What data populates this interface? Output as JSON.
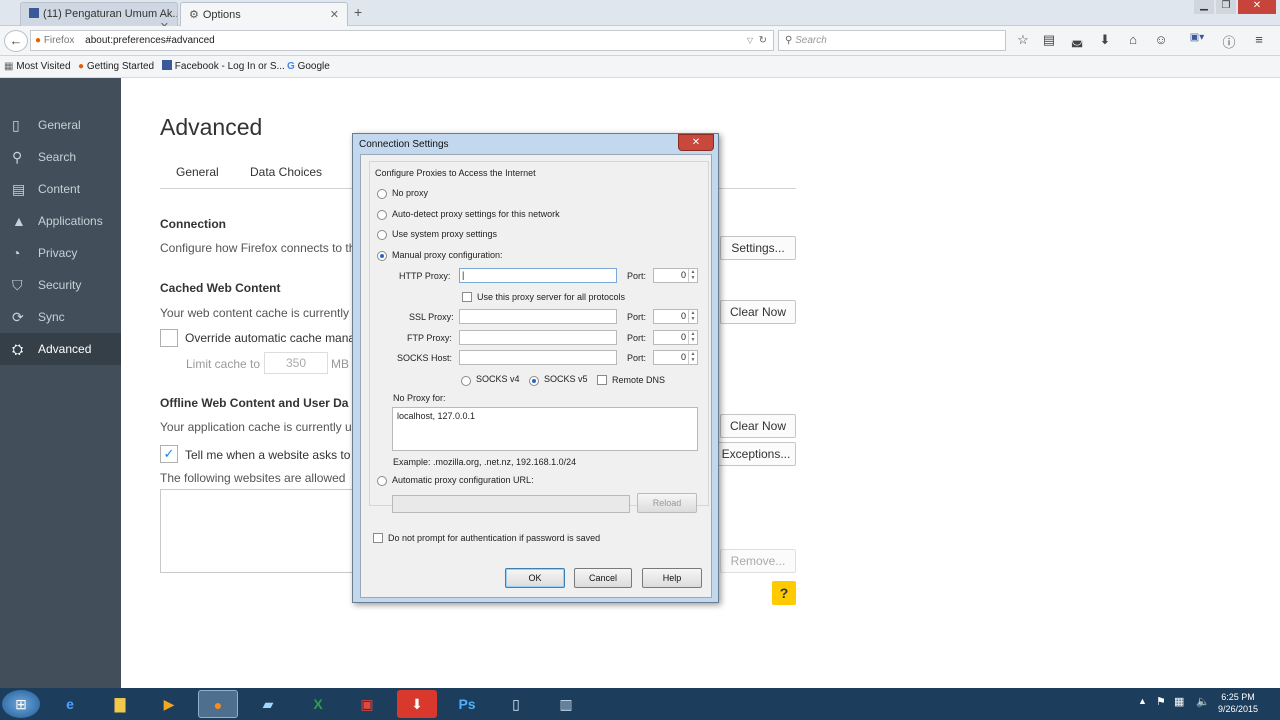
{
  "tabs": [
    {
      "label": "(11) Pengaturan Umum Ak..."
    },
    {
      "label": "Options"
    }
  ],
  "nav": {
    "firefox_label": "Firefox",
    "url": "about:preferences#advanced",
    "search_placeholder": "Search"
  },
  "bookmarks": [
    {
      "label": "Most Visited"
    },
    {
      "label": "Getting Started"
    },
    {
      "label": "Facebook - Log In or S..."
    },
    {
      "label": "Google"
    }
  ],
  "sidebar": {
    "items": [
      {
        "label": "General",
        "icon": "general-icon"
      },
      {
        "label": "Search",
        "icon": "search-icon"
      },
      {
        "label": "Content",
        "icon": "content-icon"
      },
      {
        "label": "Applications",
        "icon": "applications-icon"
      },
      {
        "label": "Privacy",
        "icon": "privacy-icon"
      },
      {
        "label": "Security",
        "icon": "security-icon"
      },
      {
        "label": "Sync",
        "icon": "sync-icon"
      },
      {
        "label": "Advanced",
        "icon": "advanced-icon",
        "active": true
      }
    ]
  },
  "main": {
    "heading": "Advanced",
    "subtabs": [
      "General",
      "Data Choices"
    ],
    "connection": {
      "title": "Connection",
      "desc": "Configure how Firefox connects to th",
      "button": "Settings..."
    },
    "cache": {
      "title": "Cached Web Content",
      "desc": "Your web content cache is currently",
      "button": "Clear Now",
      "override_label": "Override automatic cache mana",
      "limit_label": "Limit cache to",
      "limit_value": "350",
      "limit_unit": "MB"
    },
    "offline": {
      "title": "Offline Web Content and User Da",
      "desc": "Your application cache is currently u",
      "button": "Clear Now",
      "tell_label": "Tell me when a website asks to",
      "exceptions_button": "Exceptions...",
      "allowed_label": "The following websites are allowed",
      "remove_button": "Remove..."
    },
    "help_button": "?"
  },
  "dialog": {
    "title": "Connection Settings",
    "group_title": "Configure Proxies to Access the Internet",
    "no_proxy": "No proxy",
    "auto_detect": "Auto-detect proxy settings for this network",
    "system_proxy": "Use system proxy settings",
    "manual": "Manual proxy configuration:",
    "http_label": "HTTP Proxy:",
    "http_value": "",
    "port_label": "Port:",
    "http_port": "0",
    "same_proxy": "Use this proxy server for all protocols",
    "ssl_label": "SSL Proxy:",
    "ssl_port": "0",
    "ftp_label": "FTP Proxy:",
    "ftp_port": "0",
    "socks_label": "SOCKS Host:",
    "socks_port": "0",
    "socks4": "SOCKS v4",
    "socks5": "SOCKS v5",
    "remote_dns": "Remote DNS",
    "no_proxy_for": "No Proxy for:",
    "no_proxy_value": "localhost, 127.0.0.1",
    "example": "Example: .mozilla.org, .net.nz, 192.168.1.0/24",
    "auto_url": "Automatic proxy configuration URL:",
    "reload": "Reload",
    "no_prompt": "Do not prompt for authentication if password is saved",
    "ok": "OK",
    "cancel": "Cancel",
    "help": "Help"
  },
  "taskbar": {
    "time": "6:25 PM",
    "date": "9/26/2015"
  }
}
